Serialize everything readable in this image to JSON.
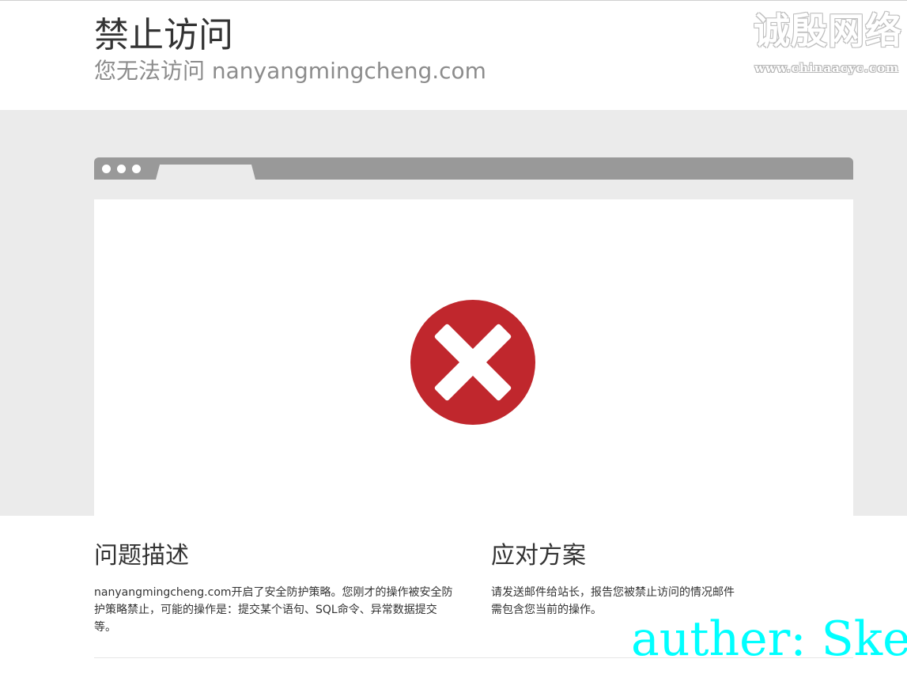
{
  "header": {
    "title": "禁止访问",
    "subtitle": "您无法访问 nanyangmingcheng.com"
  },
  "watermark": {
    "logo_text": "诚殷网络",
    "url_text": "www.chinaacyc.com"
  },
  "browser_mock": {
    "window_dots": 3,
    "error_icon": "error-x-icon",
    "error_color": "#c0272d"
  },
  "problem": {
    "title": "问题描述",
    "text": "nanyangmingcheng.com开启了安全防护策略。您刚才的操作被安全防护策略禁止，可能的操作是：提交某个语句、SQL命令、异常数据提交等。"
  },
  "solution": {
    "title": "应对方案",
    "text": "请发送邮件给站长，报告您被禁止访问的情况邮件需包含您当前的操作。"
  },
  "author_overlay": {
    "text": "auther: Ske",
    "color": "#00ffff"
  }
}
